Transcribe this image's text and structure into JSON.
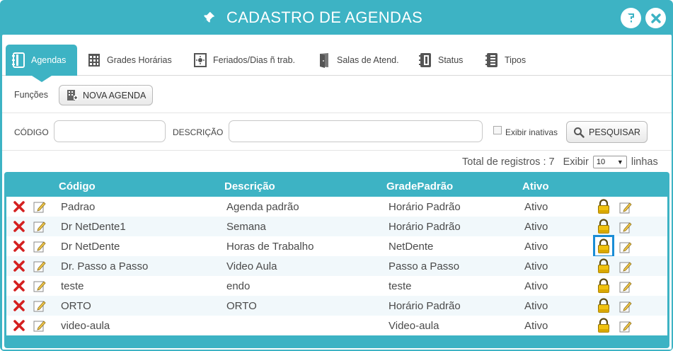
{
  "window": {
    "title": "CADASTRO DE AGENDAS",
    "colors": {
      "accent": "#3db3c4",
      "delete": "#d42020",
      "lock": "#e8b90a",
      "selection": "#1a8dd6"
    }
  },
  "tabs": [
    {
      "label": "Agendas",
      "icon": "agenda-icon",
      "active": true
    },
    {
      "label": "Grades Horárias",
      "icon": "grid-icon",
      "active": false
    },
    {
      "label": "Feriados/Dias ñ trab.",
      "icon": "holiday-icon",
      "active": false
    },
    {
      "label": "Salas de Atend.",
      "icon": "door-icon",
      "active": false
    },
    {
      "label": "Status",
      "icon": "status-icon",
      "active": false
    },
    {
      "label": "Tipos",
      "icon": "list-icon",
      "active": false
    }
  ],
  "funcoes": {
    "label": "Funções",
    "nova_agenda": "NOVA AGENDA"
  },
  "filters": {
    "codigo_label": "CÓDIGO",
    "codigo_value": "",
    "descricao_label": "DESCRIÇÃO",
    "descricao_value": "",
    "exibir_inativas_label": "Exibir inativas",
    "exibir_inativas_checked": false,
    "pesquisar": "PESQUISAR"
  },
  "summary": {
    "total_text": "Total de registros : 7",
    "exibir_label": "Exibir",
    "page_size": "10",
    "linhas_label": "linhas"
  },
  "table": {
    "headers": {
      "codigo": "Código",
      "descricao": "Descrição",
      "grade": "GradePadrão",
      "ativo": "Ativo"
    },
    "rows": [
      {
        "codigo": "Padrao",
        "descricao": "Agenda padrão",
        "grade": "Horário Padrão",
        "ativo": "Ativo"
      },
      {
        "codigo": "Dr NetDente1",
        "descricao": "Semana",
        "grade": "Horário Padrão",
        "ativo": "Ativo"
      },
      {
        "codigo": "Dr NetDente",
        "descricao": "Horas de Trabalho",
        "grade": "NetDente",
        "ativo": "Ativo"
      },
      {
        "codigo": "Dr. Passo a Passo",
        "descricao": "Video Aula",
        "grade": "Passo a Passo",
        "ativo": "Ativo"
      },
      {
        "codigo": "teste",
        "descricao": "endo",
        "grade": "teste",
        "ativo": "Ativo"
      },
      {
        "codigo": "ORTO",
        "descricao": "ORTO",
        "grade": "Horário Padrão",
        "ativo": "Ativo"
      },
      {
        "codigo": "video-aula",
        "descricao": "",
        "grade": "Video-aula",
        "ativo": "Ativo"
      }
    ]
  }
}
